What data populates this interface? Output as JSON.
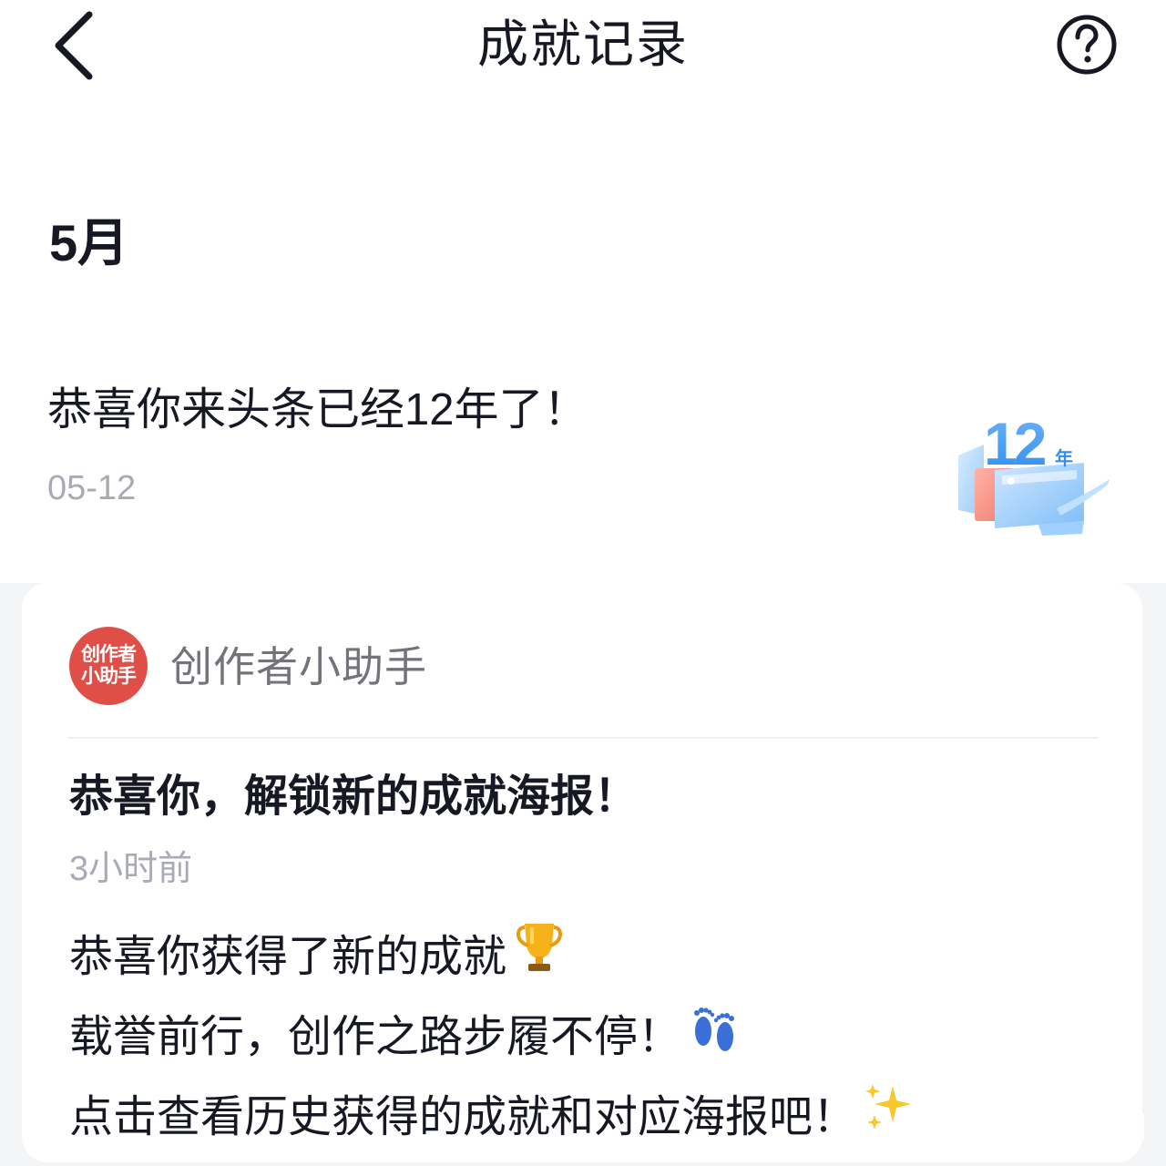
{
  "header": {
    "title": "成就记录",
    "back_icon": "chevron-left-icon",
    "help_icon": "question-circle-icon"
  },
  "month": {
    "label": "5月"
  },
  "record": {
    "title": "恭喜你来头条已经12年了！",
    "date": "05-12",
    "badge_number": "12",
    "badge_unit": "年"
  },
  "card": {
    "avatar_text_line1": "创作者",
    "avatar_text_line2": "小助手",
    "sender": "创作者小助手",
    "title": "恭喜你，解锁新的成就海报！",
    "time": "3小时前",
    "lines": [
      "恭喜你获得了新的成就",
      "载誉前行，创作之路步履不停！",
      "点击查看历史获得的成就和对应海报吧！"
    ],
    "line_emojis": [
      "trophy-icon",
      "footprints-icon",
      "sparkles-icon"
    ]
  },
  "colors": {
    "text_primary": "#161823",
    "text_secondary": "#a8abb3",
    "avatar_bg": "#e04e48",
    "page_grey": "#f4f5f6"
  }
}
